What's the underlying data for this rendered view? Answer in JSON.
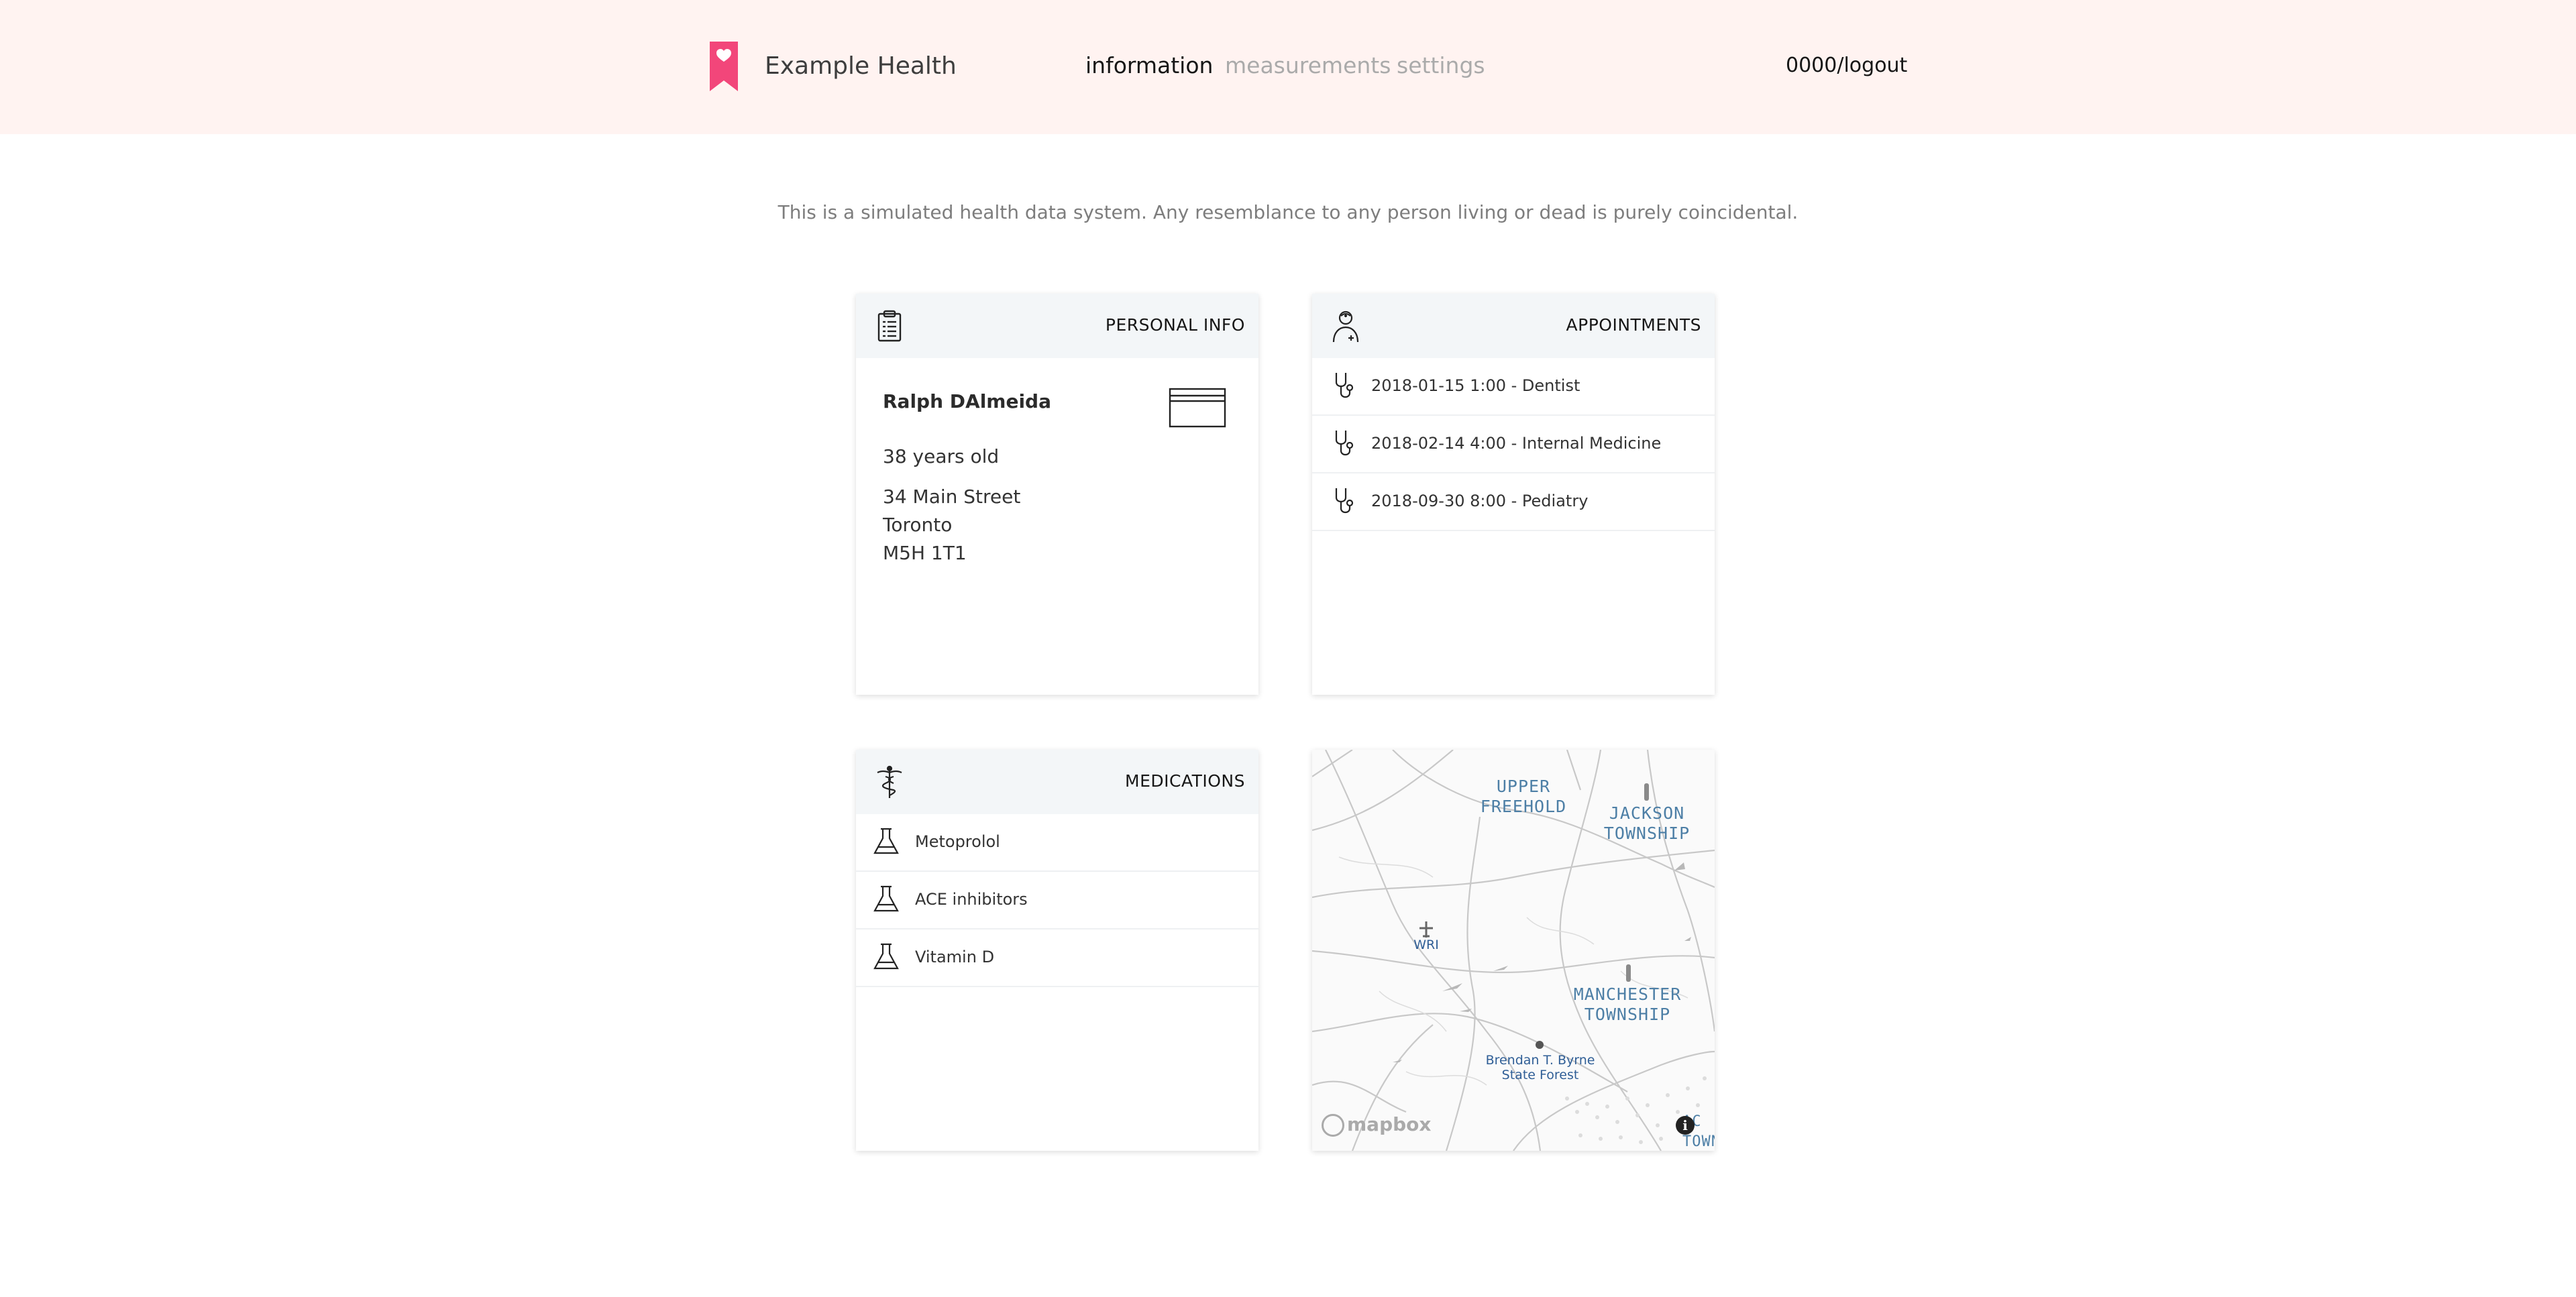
{
  "header": {
    "brand": "Example Health",
    "nav": [
      {
        "label": "information",
        "active": true
      },
      {
        "label": "measurements",
        "active": false
      },
      {
        "label": "settings",
        "active": false
      }
    ],
    "logout": "0000/logout",
    "brand_color": "#f2467a",
    "background_color": "#fff3f1"
  },
  "disclaimer": "This is a simulated health data system. Any resemblance to any person living or dead is purely coincidental.",
  "personal_info": {
    "title": "PERSONAL INFO",
    "icon": "clipboard-icon",
    "name": "Ralph DAlmeida",
    "card_icon": "id-card-icon",
    "age": "38 years old",
    "address": [
      "34 Main Street",
      "Toronto",
      "M5H 1T1"
    ]
  },
  "appointments": {
    "title": "APPOINTMENTS",
    "icon": "doctor-icon",
    "row_icon": "stethoscope-icon",
    "items": [
      "2018-01-15 1:00 - Dentist",
      "2018-02-14 4:00 - Internal Medicine",
      "2018-09-30 8:00 - Pediatry"
    ]
  },
  "medications": {
    "title": "MEDICATIONS",
    "icon": "caduceus-icon",
    "row_icon": "flask-icon",
    "items": [
      "Metoprolol",
      "ACE inhibitors",
      "Vitamin D"
    ]
  },
  "map": {
    "labels": {
      "upper_freehold": "UPPER\nFREEHOLD",
      "jackson": "JACKSON\nTOWNSHIP",
      "manchester": "MANCHESTER\nTOWNSHIP",
      "wri": "WRI",
      "forest": "Brendan T. Byrne\nState Forest",
      "edge": "AC\nTOWN"
    },
    "attribution": "mapbox",
    "info": "i"
  }
}
